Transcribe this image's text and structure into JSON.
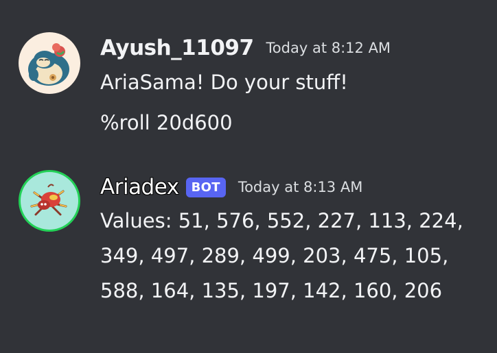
{
  "messages": [
    {
      "author": "Ayush_11097",
      "timestamp": "Today at 8:12 AM",
      "avatar_icon": "snorlax-avatar-icon",
      "lines": [
        "AriaSama! Do your stuff!",
        "%roll 20d600"
      ]
    },
    {
      "author": "Ariadex",
      "badge": "BOT",
      "timestamp": "Today at 8:13 AM",
      "avatar_icon": "ariados-avatar-icon",
      "avatar_ring_color": "#23d157",
      "values_lines": [
        "Values: 51, 576, 552, 227, 113, 224,",
        "349, 497, 289, 499, 203, 475, 105,",
        "588, 164, 135, 197, 142, 160, 206"
      ]
    }
  ],
  "theme": {
    "background": "#313338",
    "bot_badge_color": "#5865f2"
  }
}
